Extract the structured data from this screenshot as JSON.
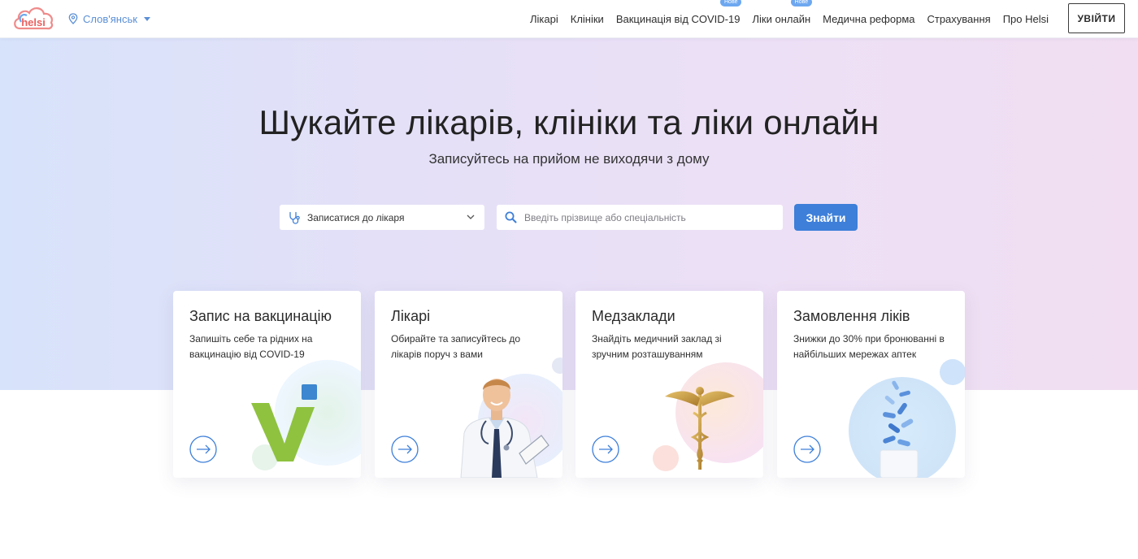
{
  "header": {
    "logo_text": "helsi",
    "city": "Слов'янськ",
    "nav": [
      {
        "label": "Лікарі",
        "badge": ""
      },
      {
        "label": "Клініки",
        "badge": ""
      },
      {
        "label": "Вакцинація від COVID-19",
        "badge": "Нове"
      },
      {
        "label": "Ліки онлайн",
        "badge": "Нове"
      },
      {
        "label": "Медична реформа",
        "badge": ""
      },
      {
        "label": "Страхування",
        "badge": ""
      },
      {
        "label": "Про Helsi",
        "badge": ""
      }
    ],
    "login_label": "УВІЙТИ"
  },
  "hero": {
    "title": "Шукайте лікарів, клініки та ліки онлайн",
    "subtitle": "Записуйтесь на прийом не виходячи з дому",
    "select_value": "Записатися до лікаря",
    "search_placeholder": "Введіть прізвище або спеціальність",
    "search_value": "",
    "find_label": "Знайти"
  },
  "cards": [
    {
      "title": "Запис на вакцинацію",
      "text": "Запишіть себе та рідних на вакцинацію від COVID-19",
      "icon": "vaccination-illustration"
    },
    {
      "title": "Лікарі",
      "text": "Обирайте та записуйтесь до лікарів поруч з вами",
      "icon": "doctor-illustration"
    },
    {
      "title": "Медзаклади",
      "text": "Знайдіть медичний заклад зі зручним розташуванням",
      "icon": "caduceus-illustration"
    },
    {
      "title": "Замовлення ліків",
      "text": "Знижки до 30% при бронюванні в найбільших мережах аптек",
      "icon": "pills-illustration"
    }
  ],
  "colors": {
    "accent": "#3d7fd9",
    "link": "#5a8fd6",
    "badge": "#6da7f0",
    "vaccine_green": "#8fc23f"
  }
}
